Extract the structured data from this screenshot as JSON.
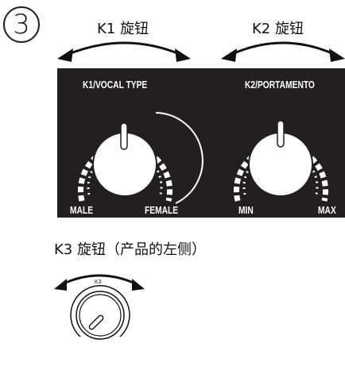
{
  "step_number": "3",
  "k1_caption": "K1 旋钮",
  "k2_caption": "K2 旋钮",
  "k3_caption": "K3 旋钮（产品的左侧）",
  "panel": {
    "k1": {
      "title": "K1/VOCAL TYPE",
      "min_label": "MALE",
      "max_label": "FEMALE"
    },
    "k2": {
      "title": "K2/PORTAMENTO",
      "min_label": "MIN",
      "max_label": "MAX"
    }
  },
  "k3_knob_label": "K3",
  "colors": {
    "panel": "#231f20",
    "ink": "#111111",
    "white": "#ffffff"
  }
}
